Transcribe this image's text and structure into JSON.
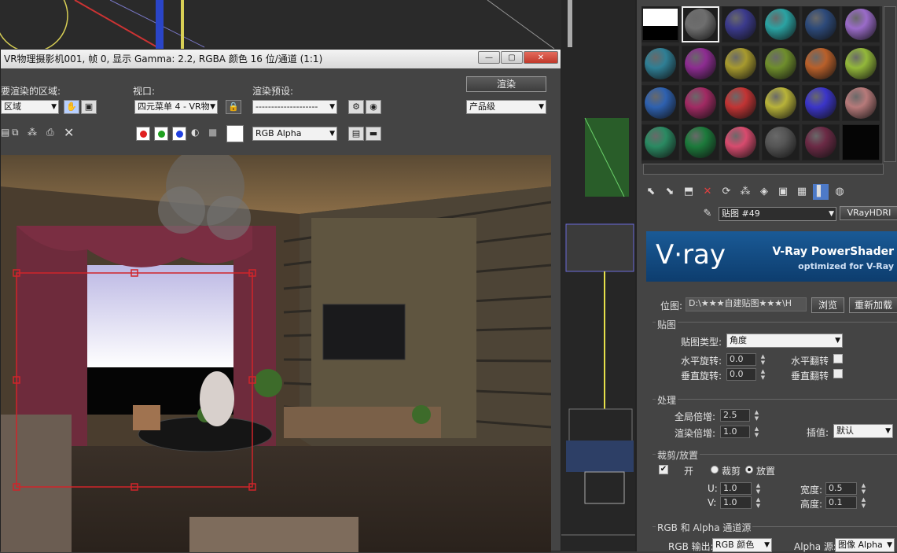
{
  "render_window": {
    "title": "VR物理摄影机001, 帧 0, 显示 Gamma: 2.2, RGBA 颜色 16 位/通道 (1:1)",
    "area_label": "要渲染的区域:",
    "area_value": "区域",
    "viewport_label": "视口:",
    "viewport_value": "四元菜单 4 - VR物",
    "preset_label": "渲染预设:",
    "preset_value": "--------------------",
    "render_button": "渲染",
    "quality_value": "产品级",
    "channel_value": "RGB Alpha",
    "win_min": "—",
    "win_max": "▢",
    "win_close": "✕"
  },
  "material_editor": {
    "spheres": [
      [
        "#ffffff",
        "#6e6e6e",
        "#3b3a8c",
        "#2aa3a3",
        "#2d4a7a",
        "#9a6bc9"
      ],
      [
        "#2f7f95",
        "#8d2c91",
        "#a79a2e",
        "#6f8e2c",
        "#b9602a",
        "#93b83a"
      ],
      [
        "#2e61b0",
        "#a12a63",
        "#c23434",
        "#b8b339",
        "#3b35c9",
        "#b77a7a"
      ],
      [
        "#2a8a62",
        "#1c7a3b",
        "#d84b6e",
        "#555555",
        "#6b2a45",
        "#050505"
      ]
    ],
    "map_name": "贴图 #49",
    "map_type": "VRayHDRI",
    "vray_logo": "V·ray",
    "banner_title": "V-Ray PowerShader",
    "banner_sub": "optimized for V-Ray",
    "bitmap_label": "位图:",
    "bitmap_path": "D:\\★★★自建贴图★★★\\H",
    "browse_btn": "浏览",
    "reload_btn": "重新加载",
    "mapping": {
      "title": "贴图",
      "type_label": "贴图类型:",
      "type_value": "角度",
      "h_rot_label": "水平旋转:",
      "h_rot_value": "0.0",
      "v_rot_label": "垂直旋转:",
      "v_rot_value": "0.0",
      "h_flip_label": "水平翻转",
      "v_flip_label": "垂直翻转"
    },
    "processing": {
      "title": "处理",
      "overall_label": "全局倍增:",
      "overall_value": "2.5",
      "render_label": "渲染倍增:",
      "render_value": "1.0",
      "interp_label": "插值:",
      "interp_value": "默认"
    },
    "crop": {
      "title": "裁剪/放置",
      "on_label": "开",
      "crop_label": "裁剪",
      "place_label": "放置",
      "u_label": "U:",
      "u_value": "1.0",
      "v_label": "V:",
      "v_value": "1.0",
      "w_label": "宽度:",
      "w_value": "0.5",
      "h_label": "高度:",
      "h_value": "0.1"
    },
    "rgb_alpha": {
      "title": "RGB 和 Alpha 通道源",
      "rgb_out_label": "RGB 输出:",
      "rgb_out_value": "RGB 颜色",
      "alpha_src_label": "Alpha 源:",
      "alpha_src_value": "图像 Alpha"
    }
  }
}
